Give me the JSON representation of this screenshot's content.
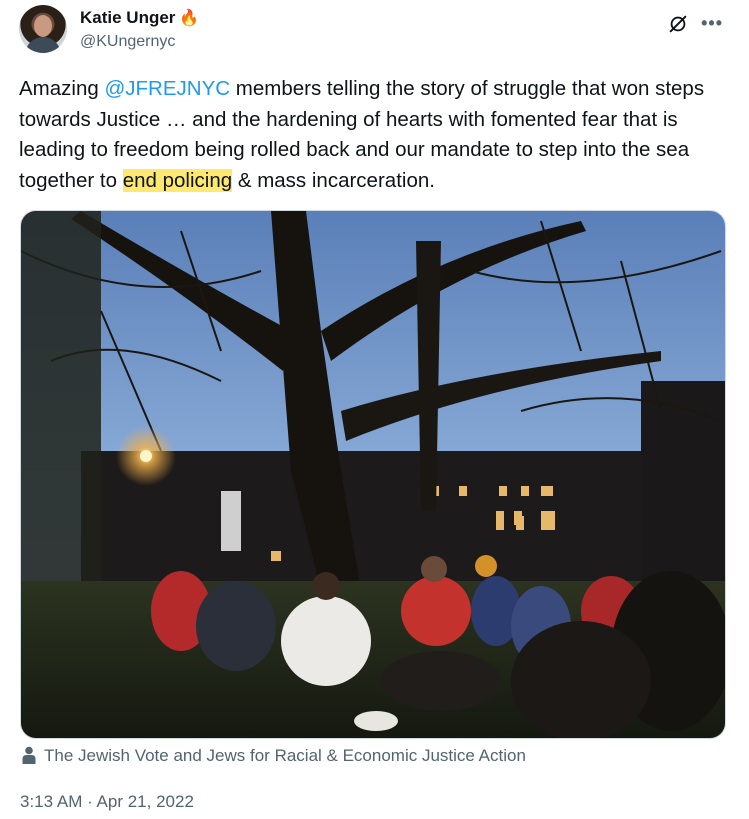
{
  "author": {
    "name": "Katie Unger",
    "name_emoji": "🔥",
    "handle": "@KUngernyc"
  },
  "tweet": {
    "text_before_mention": "Amazing ",
    "mention": "@JFREJNYC",
    "text_after_mention": " members telling the story of struggle that won steps towards Justice … and the hardening of hearts with fomented fear that is leading to freedom being rolled back and our mandate to step into the sea together to ",
    "highlighted": "end policing",
    "text_end": " & mass incarceration."
  },
  "media": {
    "caption": "The Jewish Vote and Jews for Racial & Economic Justice Action"
  },
  "timestamp": "3:13 AM · Apr 21, 2022",
  "icons": {
    "grok": "grok-icon",
    "more": "more-options-icon",
    "person": "person-icon"
  },
  "colors": {
    "link": "#1d9bf0",
    "secondary_text": "#536471",
    "highlight": "#fde872"
  }
}
